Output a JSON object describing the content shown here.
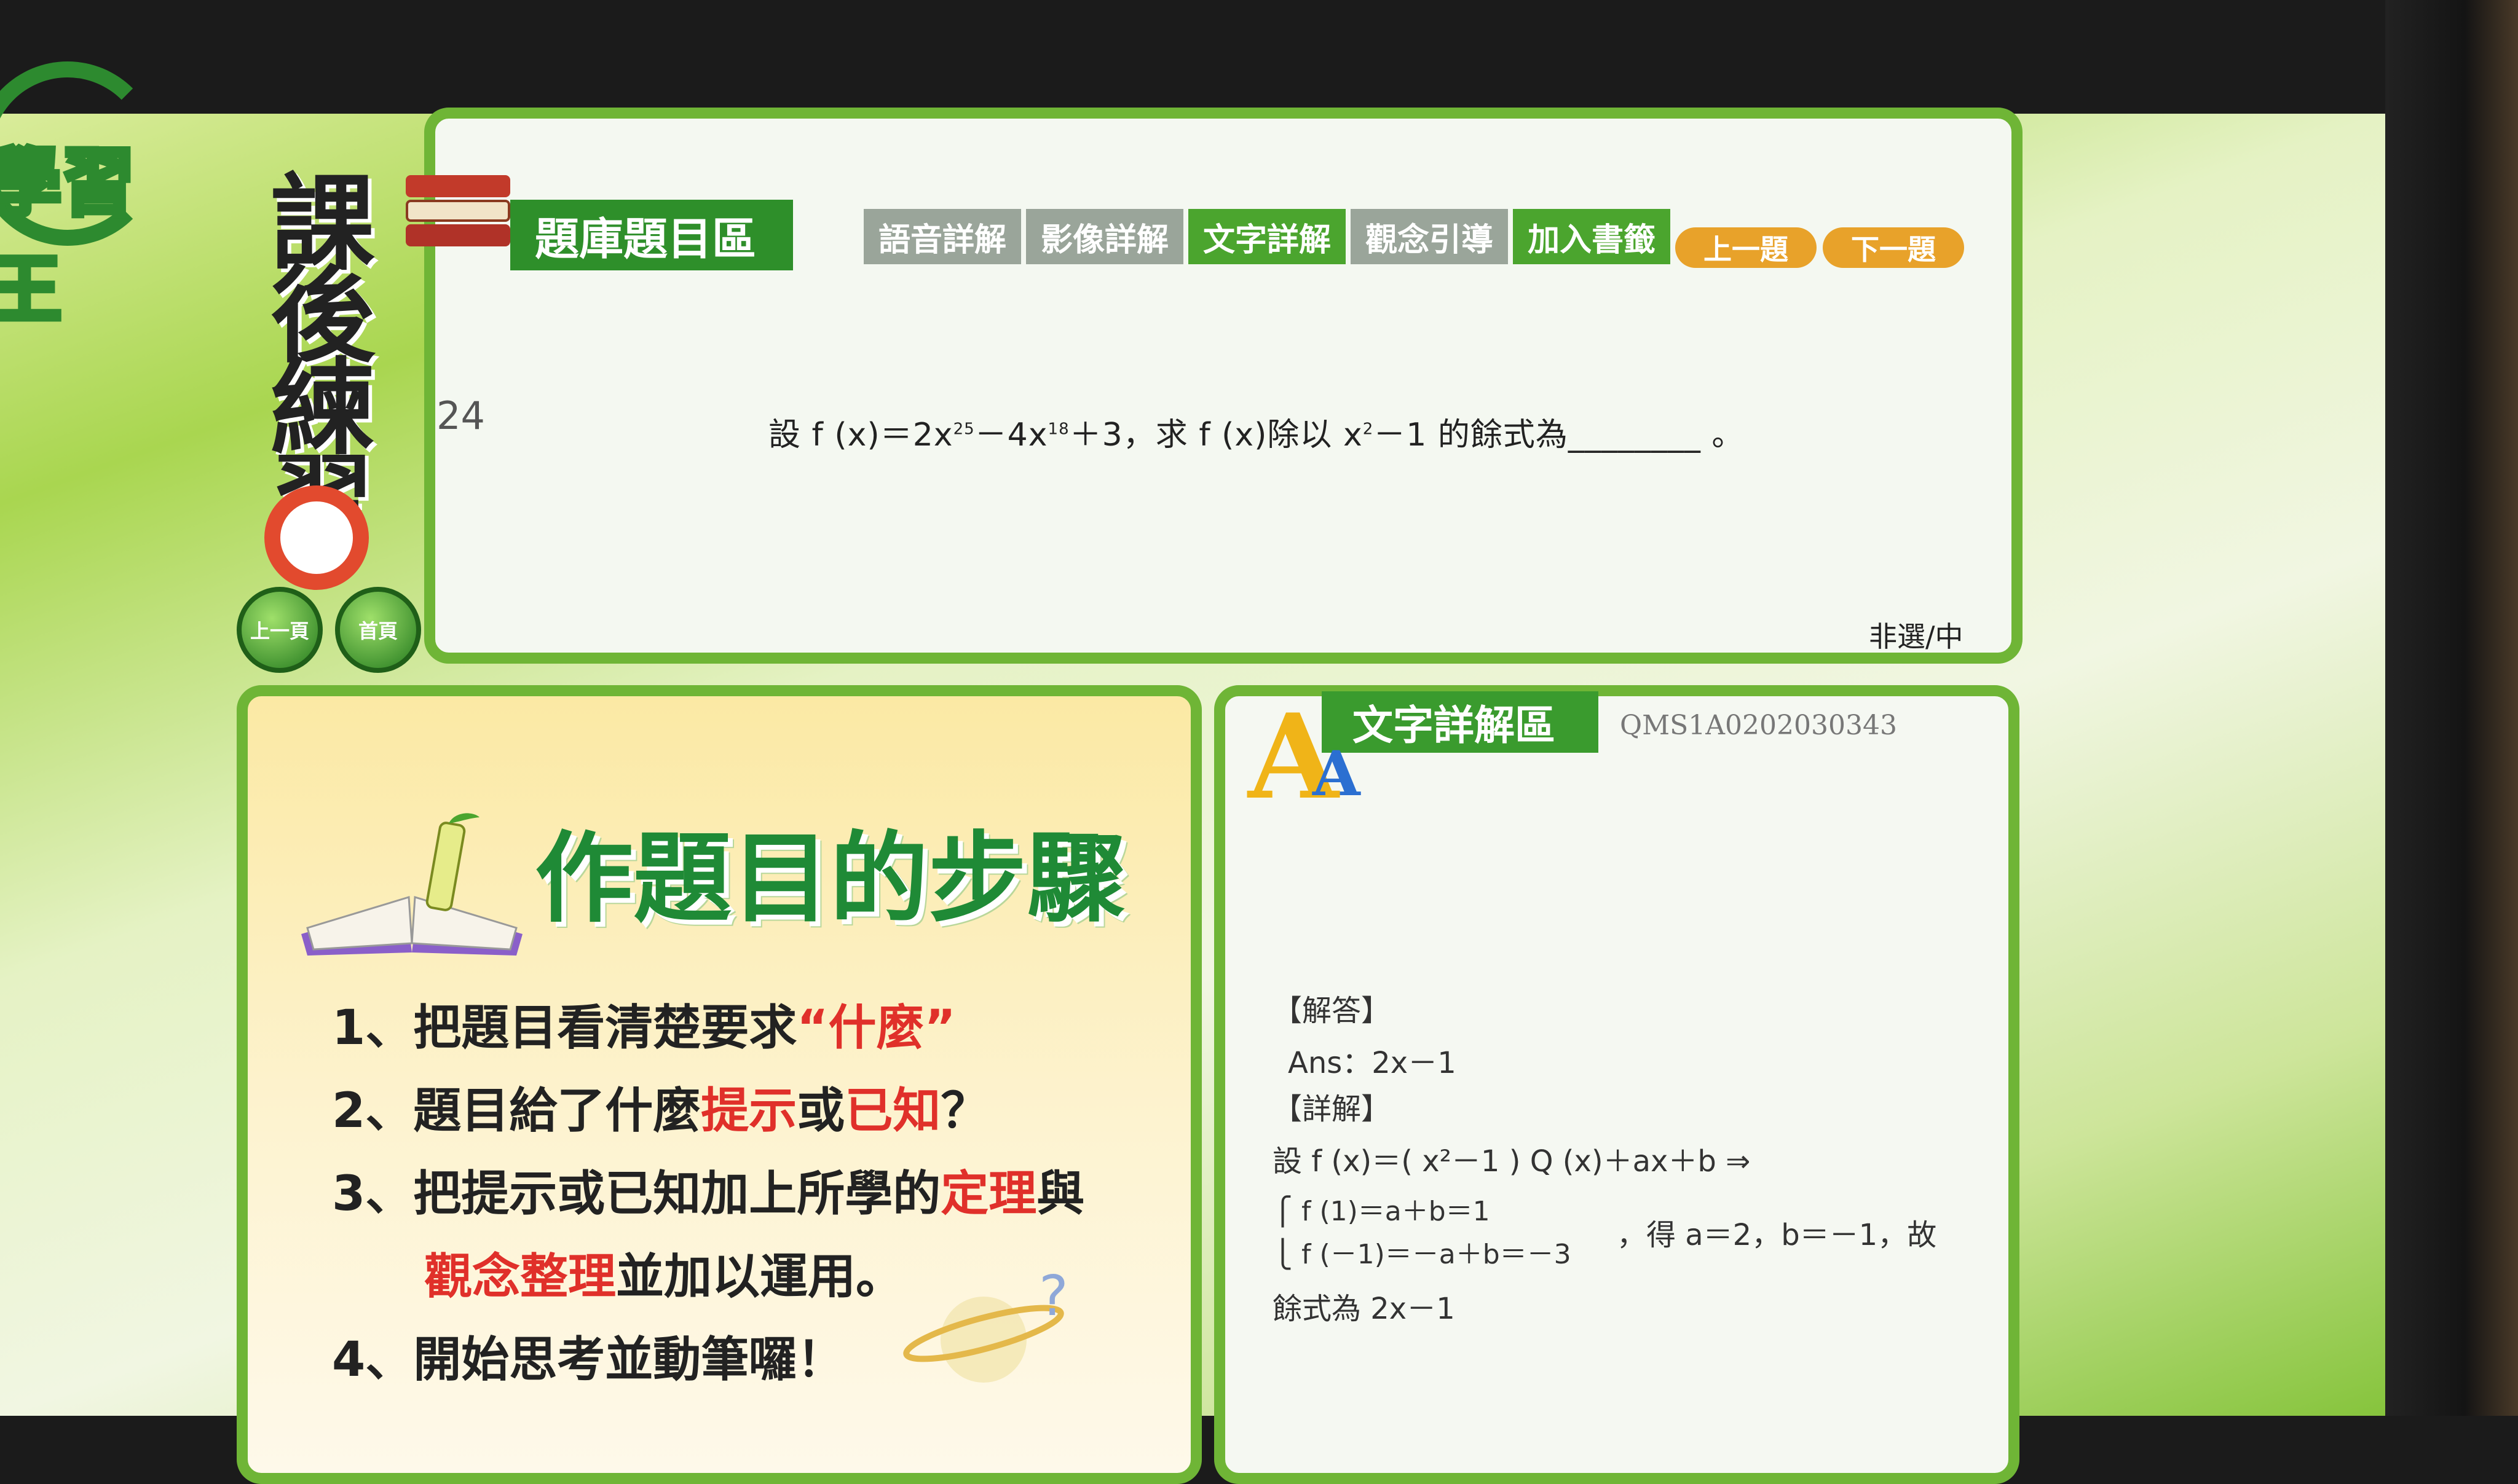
{
  "logo": {
    "text": "學習王"
  },
  "sidebar": {
    "vertical_title": [
      "課",
      "後",
      "練",
      "習"
    ],
    "prev_page_btn": "上一頁",
    "home_btn": "首頁"
  },
  "question_panel": {
    "title": "題庫題目區",
    "tabs": [
      {
        "label": "語音詳解",
        "active": false
      },
      {
        "label": "影像詳解",
        "active": false
      },
      {
        "label": "文字詳解",
        "active": true
      },
      {
        "label": "觀念引導",
        "active": false
      },
      {
        "label": "加入書籤",
        "active": true
      }
    ],
    "prev_question": "上一題",
    "next_question": "下一題",
    "number": "24",
    "text_prefix": "設 f (x)＝2x",
    "exp1": "25",
    "text_mid1": "－4x",
    "exp2": "18",
    "text_mid2": "＋3，求 f (x)除以 x",
    "exp3": "2",
    "text_suffix": "－1 的餘式為________ 。",
    "difficulty": "非選/中"
  },
  "steps_panel": {
    "title": "作題目的步驟",
    "step1_pre": "1、把題目看清楚要求",
    "step1_hl": "“什麼”",
    "step2_pre": "2、題目給了什麼",
    "step2_hl1": "提示",
    "step2_mid": "或",
    "step2_hl2": "已知",
    "step2_post": "？",
    "step3_pre": "3、把提示或已知加上所學的",
    "step3_hl": "定理",
    "step3_post": "與",
    "step3b_hl": "觀念整理",
    "step3b_post": "並加以運用。",
    "step4": "4、開始思考並動筆囉！"
  },
  "answer_panel": {
    "title": "文字詳解區",
    "code": "QMS1A0202030343",
    "answer_label": "【解答】",
    "answer": "Ans：2x－1",
    "detail_label": "【詳解】",
    "line1": "設 f (x)＝( x²－1 ) Q (x)＋ax＋b ⇒",
    "line2": "⎧ f (1)＝a＋b＝1",
    "line3": "⎩ f (－1)＝－a＋b＝－3",
    "line3_tail": "，得 a＝2，b＝－1，故",
    "line4": "餘式為 2x－1"
  },
  "colors": {
    "green": "#4ba52e",
    "red": "#e0302a",
    "orange": "#e8a22a"
  }
}
